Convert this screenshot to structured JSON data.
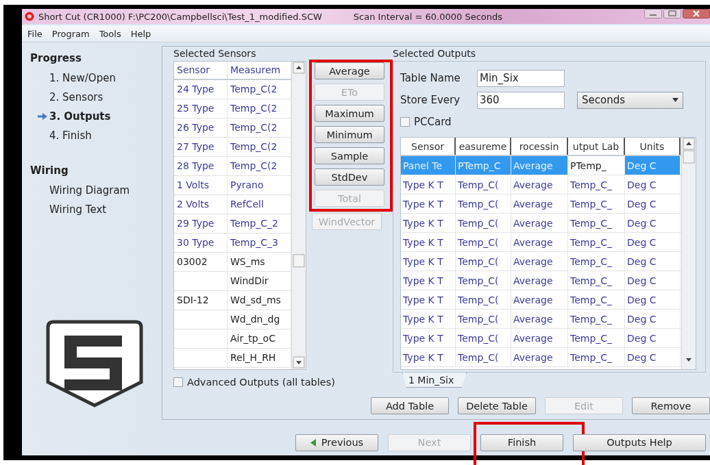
{
  "window": {
    "title": "Short Cut (CR1000) F:\\PC200\\Campbellsci\\Test_1_modified.SCW",
    "scan_interval": "Scan Interval = 60.0000 Seconds"
  },
  "menu": [
    "File",
    "Program",
    "Tools",
    "Help"
  ],
  "sidebar": {
    "sections": [
      {
        "title": "Progress",
        "items": [
          {
            "label": "1. New/Open",
            "selected": false
          },
          {
            "label": "2. Sensors",
            "selected": false
          },
          {
            "label": "3. Outputs",
            "selected": true
          },
          {
            "label": "4. Finish",
            "selected": false
          }
        ]
      },
      {
        "title": "Wiring",
        "items": [
          {
            "label": "Wiring Diagram",
            "selected": false
          },
          {
            "label": "Wiring Text",
            "selected": false
          }
        ]
      }
    ]
  },
  "selected_sensors": {
    "title": "Selected Sensors",
    "columns": [
      "Sensor",
      "Measurem"
    ],
    "rows": [
      {
        "sensor": "24 Type",
        "measurement": "Temp_C(2",
        "color": "#3a3a9c"
      },
      {
        "sensor": "25 Type",
        "measurement": "Temp_C(2",
        "color": "#3a3a9c"
      },
      {
        "sensor": "26 Type",
        "measurement": "Temp_C(2",
        "color": "#3a3a9c"
      },
      {
        "sensor": "27 Type",
        "measurement": "Temp_C(2",
        "color": "#3a3a9c"
      },
      {
        "sensor": "28 Type",
        "measurement": "Temp_C(2",
        "color": "#3a3a9c"
      },
      {
        "sensor": "1 Volts",
        "measurement": "Pyrano",
        "color": "#3a3a9c"
      },
      {
        "sensor": "2 Volts",
        "measurement": "RefCell",
        "color": "#3a3a9c"
      },
      {
        "sensor": "29 Type",
        "measurement": "Temp_C_2",
        "color": "#3a3a9c"
      },
      {
        "sensor": "30 Type",
        "measurement": "Temp_C_3",
        "color": "#3a3a9c"
      },
      {
        "sensor": "03002",
        "measurement": "WS_ms",
        "color": "#222222"
      },
      {
        "measurement": "WindDir",
        "color": "#222222"
      },
      {
        "sensor": "SDI-12",
        "measurement": "Wd_sd_ms",
        "color": "#222222"
      },
      {
        "measurement": "Wd_dn_dg",
        "color": "#222222"
      },
      {
        "measurement": "Air_tp_oC",
        "color": "#222222"
      },
      {
        "measurement": "Rel_H_RH",
        "color": "#222222"
      }
    ]
  },
  "processing_buttons": [
    {
      "label": "Average",
      "disabled": false
    },
    {
      "label": "ETo",
      "disabled": true
    },
    {
      "label": "Maximum",
      "disabled": false
    },
    {
      "label": "Minimum",
      "disabled": false
    },
    {
      "label": "Sample",
      "disabled": false
    },
    {
      "label": "StdDev",
      "disabled": false
    },
    {
      "label": "Total",
      "disabled": true
    },
    {
      "label": "WindVector",
      "disabled": true
    }
  ],
  "advanced_outputs": {
    "label": "Advanced Outputs (all tables)",
    "checked": false
  },
  "selected_outputs": {
    "title": "Selected Outputs",
    "table_name": {
      "label": "Table Name",
      "value": "Min_Six"
    },
    "store_every": {
      "label": "Store Every",
      "value": "360",
      "unit": "Seconds"
    },
    "pccard": {
      "label": "PCCard",
      "checked": false
    },
    "columns": [
      "Sensor",
      "easureme",
      "rocessin",
      "utput Lab",
      "Units"
    ],
    "rows": [
      {
        "cells": [
          "Panel Te",
          "PTemp_C",
          "Average",
          "PTemp_",
          "Deg C"
        ],
        "selected": true
      },
      {
        "cells": [
          "Type K T",
          "Temp_C(",
          "Average",
          "Temp_C_",
          "Deg C"
        ],
        "selected": false
      },
      {
        "cells": [
          "Type K T",
          "Temp_C(",
          "Average",
          "Temp_C_",
          "Deg C"
        ],
        "selected": false
      },
      {
        "cells": [
          "Type K T",
          "Temp_C(",
          "Average",
          "Temp_C_",
          "Deg C"
        ],
        "selected": false
      },
      {
        "cells": [
          "Type K T",
          "Temp_C(",
          "Average",
          "Temp_C_",
          "Deg C"
        ],
        "selected": false
      },
      {
        "cells": [
          "Type K T",
          "Temp_C(",
          "Average",
          "Temp_C_",
          "Deg C"
        ],
        "selected": false
      },
      {
        "cells": [
          "Type K T",
          "Temp_C(",
          "Average",
          "Temp_C_",
          "Deg C"
        ],
        "selected": false
      },
      {
        "cells": [
          "Type K T",
          "Temp_C(",
          "Average",
          "Temp_C_",
          "Deg C"
        ],
        "selected": false
      },
      {
        "cells": [
          "Type K T",
          "Temp_C(",
          "Average",
          "Temp_C_",
          "Deg C"
        ],
        "selected": false
      },
      {
        "cells": [
          "Type K T",
          "Temp_C(",
          "Average",
          "Temp_C_",
          "Deg C"
        ],
        "selected": false
      },
      {
        "cells": [
          "Type K T",
          "Temp_C(",
          "Average",
          "Temp_C_",
          "Deg C"
        ],
        "selected": false
      }
    ],
    "tabs": [
      {
        "label": "1 Min_Six",
        "selected": true
      }
    ]
  },
  "table_buttons": [
    {
      "label": "Add Table",
      "disabled": false
    },
    {
      "label": "Delete Table",
      "disabled": false
    },
    {
      "label": "Edit",
      "disabled": true
    },
    {
      "label": "Remove",
      "disabled": false
    }
  ],
  "nav_buttons": [
    {
      "label": "Previous",
      "kind": "back",
      "disabled": false,
      "highlighted": false
    },
    {
      "label": "Next",
      "kind": "plain",
      "disabled": true,
      "highlighted": false
    },
    {
      "label": "Finish",
      "kind": "plain",
      "disabled": false,
      "highlighted": true
    },
    {
      "label": "Outputs Help",
      "kind": "plain",
      "disabled": false,
      "highlighted": false
    }
  ]
}
